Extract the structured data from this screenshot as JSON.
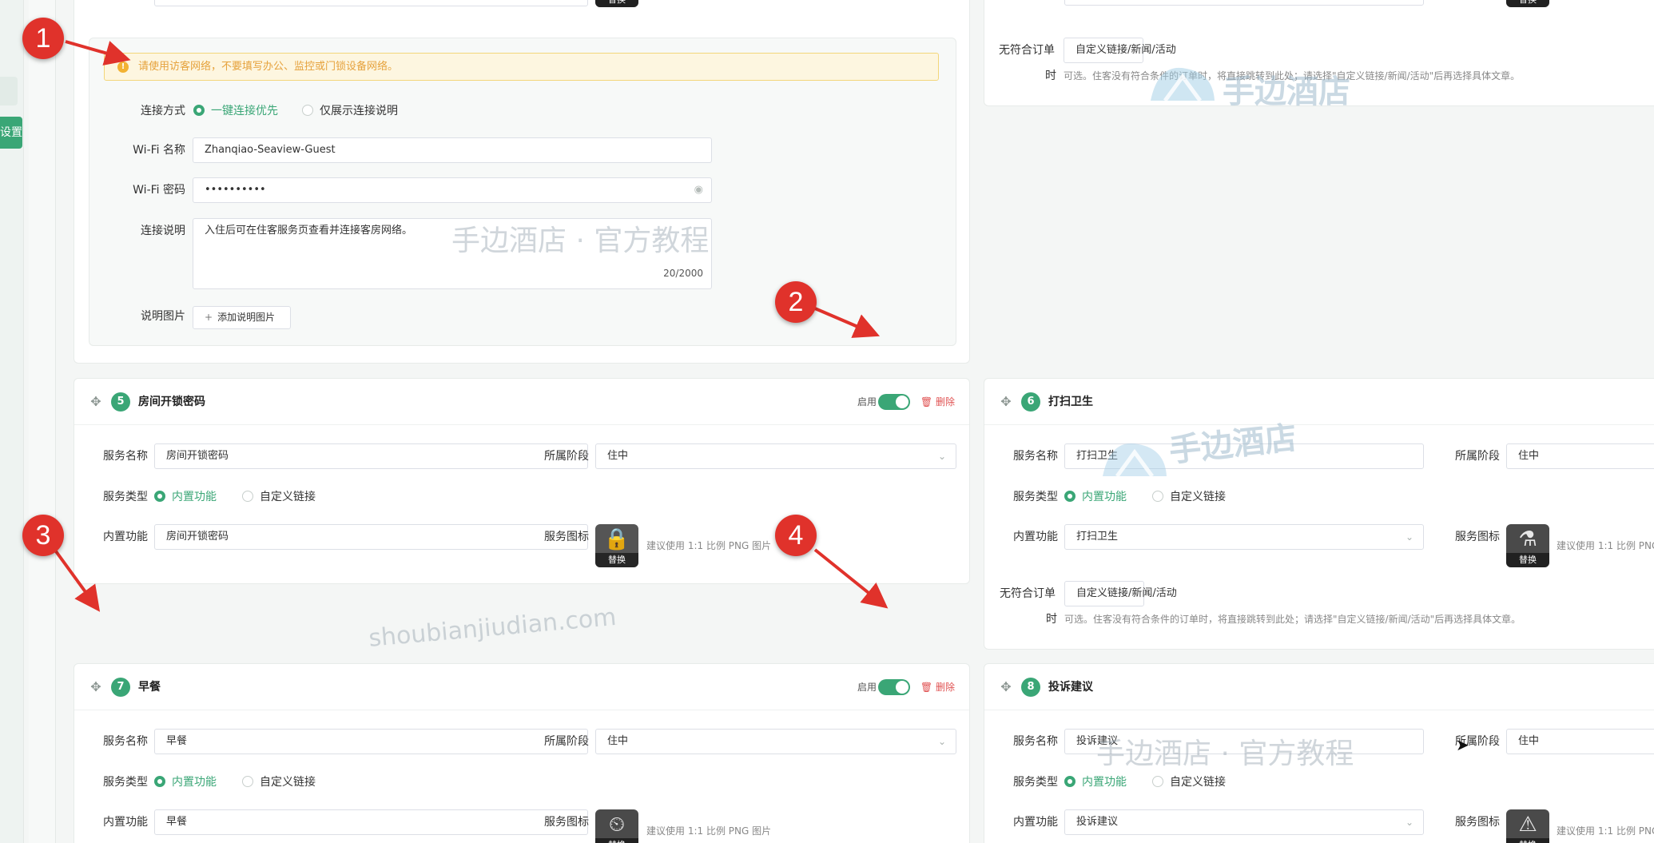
{
  "sidebar": {
    "settings_tab": "设置"
  },
  "common": {
    "enable_label": "启用",
    "delete_label": "删除",
    "service_name_label": "服务名称",
    "stage_label": "所属阶段",
    "service_type_label": "服务类型",
    "builtin_radio": "内置功能",
    "custom_radio": "自定义链接",
    "builtin_func_label": "内置功能",
    "service_icon_label": "服务图标",
    "icon_hint": "建议使用 1:1 比例 PNG 图片",
    "icon_hint_cut": "建议使用 1:1 比例 PNG",
    "swap_label": "替换",
    "no_order_label_line1": "无符合订单",
    "no_order_label_line2": "时",
    "no_order_value": "自定义链接/新闻/活动",
    "no_order_hint": "可选。住客没有符合条件的订单时，将直接跳转到此处；请选择\"自定义链接/新闻/活动\"后再选择具体文章。"
  },
  "wifi": {
    "alert": "请使用访客网络，不要填写办公、监控或门锁设备网络。",
    "connect_mode_label": "连接方式",
    "mode_one_click": "一键连接优先",
    "mode_desc_only": "仅展示连接说明",
    "ssid_label": "Wi-Fi 名称",
    "ssid_value": "Zhanqiao-Seaview-Guest",
    "password_label": "Wi-Fi 密码",
    "password_value": "••••••••••",
    "desc_label": "连接说明",
    "desc_value": "入住后可在住客服务页查看并连接客房网络。",
    "desc_count": "20/2000",
    "image_label": "说明图片",
    "add_image_button": "添加说明图片"
  },
  "cards": [
    {
      "num": "5",
      "title": "房间开锁密码",
      "name": "房间开锁密码",
      "stage": "住中",
      "func": "房间开锁密码",
      "icon": "lock-icon"
    },
    {
      "num": "6",
      "title": "打扫卫生",
      "name": "打扫卫生",
      "stage": "住中",
      "func": "打扫卫生",
      "icon": "cleaning-icon"
    },
    {
      "num": "7",
      "title": "早餐",
      "name": "早餐",
      "stage": "住中",
      "func": "早餐",
      "icon": "breakfast-icon"
    },
    {
      "num": "8",
      "title": "投诉建议",
      "name": "投诉建议",
      "stage": "住中",
      "func": "投诉建议",
      "icon": "complaint-icon"
    }
  ],
  "markers": [
    "1",
    "2",
    "3",
    "4"
  ],
  "watermarks": {
    "brand": "手边酒店",
    "tutorial": "手边酒店 · 官方教程",
    "domain": "shoubianjiudian.com"
  },
  "colors": {
    "accent": "#3aa676",
    "danger": "#e05252",
    "marker": "#e0322b",
    "warning": "#e6a23c"
  }
}
